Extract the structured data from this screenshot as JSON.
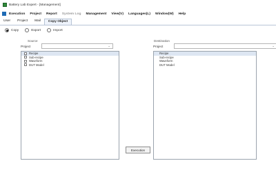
{
  "window": {
    "title": "Battery Lab Expert - [Management]"
  },
  "menu": {
    "items": [
      {
        "label": "Execution",
        "disabled": false
      },
      {
        "label": "Project",
        "disabled": false
      },
      {
        "label": "Report",
        "disabled": false
      },
      {
        "label": "System Log",
        "disabled": true
      },
      {
        "label": "Management",
        "disabled": false
      },
      {
        "label": "View(V)",
        "disabled": false
      },
      {
        "label": "Languages(L)",
        "disabled": false
      },
      {
        "label": "Window(W)",
        "disabled": false
      },
      {
        "label": "Help",
        "disabled": false
      }
    ]
  },
  "tabs": [
    {
      "label": "User",
      "active": false
    },
    {
      "label": "Project",
      "active": false
    },
    {
      "label": "Mail",
      "active": false
    },
    {
      "label": "Copy Object",
      "active": true
    }
  ],
  "mode": {
    "options": [
      "Copy",
      "Export",
      "Import"
    ],
    "selected": "Copy"
  },
  "source": {
    "title": "Source",
    "project_label": "Project",
    "project_value": "",
    "items": [
      "Recipe",
      "Sub-recipe",
      "Waveform",
      "DUT Model"
    ]
  },
  "destination": {
    "title": "Destination",
    "project_label": "Project",
    "project_value": "",
    "items": [
      "Recipe",
      "Sub-recipe",
      "Waveform",
      "DUT Model"
    ]
  },
  "actions": {
    "execute_label": "Execution"
  },
  "colors": {
    "accent": "#1f6bb5",
    "selection": "#dde6f2",
    "app_icon": "#2e8b3a"
  },
  "icons": {
    "app": "battery-app-icon",
    "menu": "app-menu-icon",
    "chevron": "chevron-down-icon"
  }
}
